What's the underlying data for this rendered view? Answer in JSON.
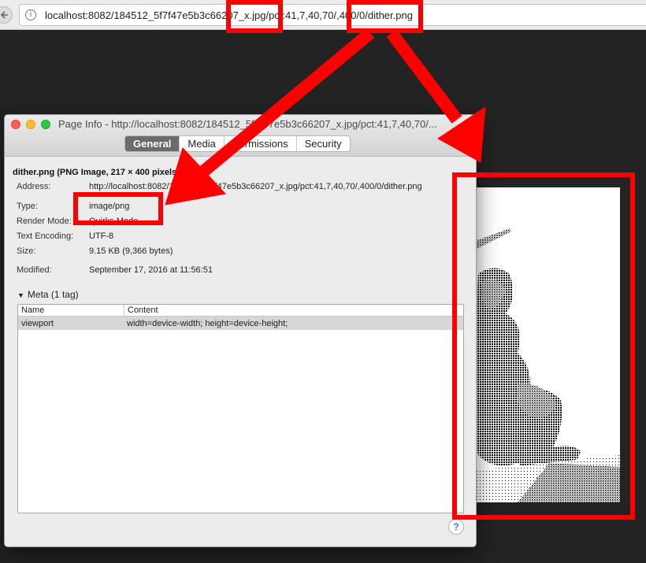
{
  "browser": {
    "url": "localhost:8082/184512_5f7f47e5b3c66207_x.jpg/pct:41,7,40,70/,400/0/dither.png",
    "icons": [
      "back-arrow-icon",
      "info-icon"
    ]
  },
  "dialog": {
    "title": "Page Info - http://localhost:8082/184512_5f7f47e5b3c66207_x.jpg/pct:41,7,40,70/...",
    "tabs": [
      "General",
      "Media",
      "Permissions",
      "Security"
    ],
    "active_tab": "General",
    "heading": "dither.png (PNG Image, 217 × 400 pixels)",
    "fields": {
      "address_label": "Address:",
      "address_value": "http://localhost:8082/184512_5f7f47e5b3c66207_x.jpg/pct:41,7,40,70/,400/0/dither.png",
      "type_label": "Type:",
      "type_value": "image/png",
      "render_label": "Render Mode:",
      "render_value": "Quirks Mode",
      "encoding_label": "Text Encoding:",
      "encoding_value": "UTF-8",
      "size_label": "Size:",
      "size_value": "9.15 KB (9,366 bytes)",
      "modified_label": "Modified:",
      "modified_value": "September 17, 2016 at 11:56:51"
    },
    "meta": {
      "header": "Meta (1 tag)",
      "columns": [
        "Name",
        "Content"
      ],
      "rows": [
        {
          "name": "viewport",
          "content": "width=device-width; height=device-height;"
        }
      ]
    },
    "help_label": "?"
  },
  "colors": {
    "annotation": "#ff0000",
    "background": "#232323",
    "active_tab": "#6b6b6b"
  }
}
